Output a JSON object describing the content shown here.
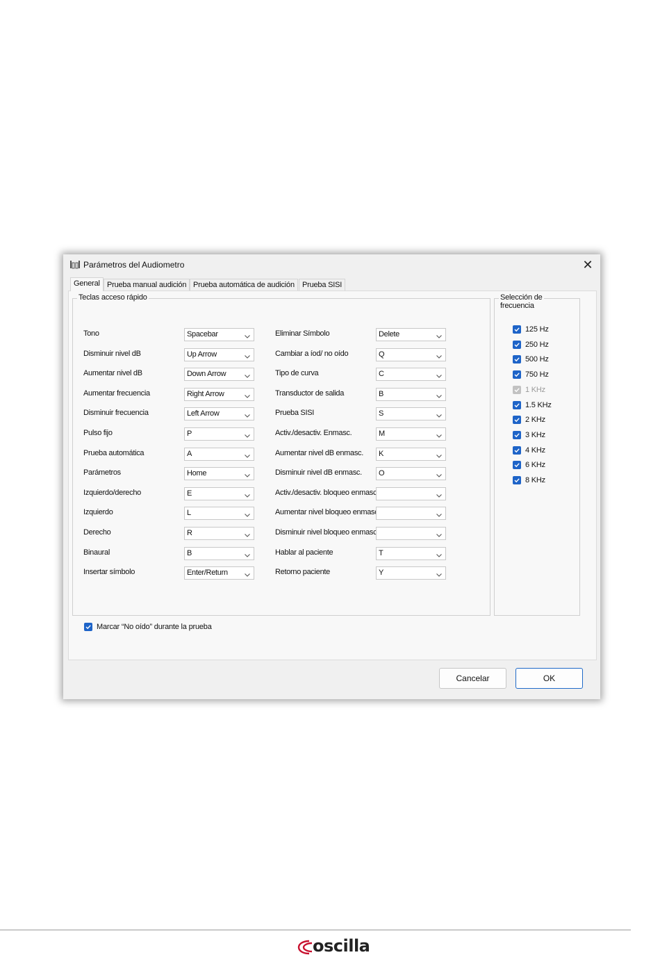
{
  "window": {
    "title": "Parámetros del Audiometro"
  },
  "tabs": [
    "General",
    "Prueba manual audición",
    "Prueba automática de audición",
    "Prueba SISI"
  ],
  "shortcuts": {
    "group_label": "Teclas acceso rápido",
    "left": [
      {
        "label": "Tono",
        "value": "Spacebar"
      },
      {
        "label": "Disminuir nivel dB",
        "value": "Up Arrow"
      },
      {
        "label": "Aumentar nivel dB",
        "value": "Down Arrow"
      },
      {
        "label": "Aumentar frecuencia",
        "value": "Right Arrow"
      },
      {
        "label": "Disminuir frecuencia",
        "value": "Left Arrow"
      },
      {
        "label": "Pulso fijo",
        "value": "P"
      },
      {
        "label": "Prueba automática",
        "value": "A"
      },
      {
        "label": "Parámetros",
        "value": "Home"
      },
      {
        "label": "Izquierdo/derecho",
        "value": "E"
      },
      {
        "label": "Izquierdo",
        "value": "L"
      },
      {
        "label": "Derecho",
        "value": "R"
      },
      {
        "label": "Binaural",
        "value": "B"
      },
      {
        "label": "Insertar símbolo",
        "value": "Enter/Return"
      }
    ],
    "right": [
      {
        "label": "Eliminar Símbolo",
        "value": "Delete"
      },
      {
        "label": "Cambiar a íod/ no oído",
        "value": "Q"
      },
      {
        "label": "Tipo de curva",
        "value": "C"
      },
      {
        "label": "Transductor de salida",
        "value": "B"
      },
      {
        "label": "Prueba SISI",
        "value": "S"
      },
      {
        "label": "Activ./desactiv. Enmasc.",
        "value": "M"
      },
      {
        "label": "Aumentar nivel dB enmasc.",
        "value": "K"
      },
      {
        "label": "Disminuir nivel dB enmasc.",
        "value": "O"
      },
      {
        "label": "Activ./desactiv. bloqueo enmasc.",
        "value": ""
      },
      {
        "label": "Aumentar nivel bloqueo enmasc.",
        "value": ""
      },
      {
        "label": "Disminuir nivel bloqueo enmasc.",
        "value": ""
      },
      {
        "label": "Hablar al paciente",
        "value": "T"
      },
      {
        "label": "Retorno paciente",
        "value": "Y"
      }
    ]
  },
  "frequency": {
    "group_label_line1": "Selección de",
    "group_label_line2": "frecuencia",
    "items": [
      {
        "label": "125 Hz",
        "checked": true,
        "disabled": false
      },
      {
        "label": "250 Hz",
        "checked": true,
        "disabled": false
      },
      {
        "label": "500 Hz",
        "checked": true,
        "disabled": false
      },
      {
        "label": "750 Hz",
        "checked": true,
        "disabled": false
      },
      {
        "label": "1 KHz",
        "checked": true,
        "disabled": true
      },
      {
        "label": "1.5 KHz",
        "checked": true,
        "disabled": false
      },
      {
        "label": "2 KHz",
        "checked": true,
        "disabled": false
      },
      {
        "label": "3 KHz",
        "checked": true,
        "disabled": false
      },
      {
        "label": "4 KHz",
        "checked": true,
        "disabled": false
      },
      {
        "label": "6 KHz",
        "checked": true,
        "disabled": false
      },
      {
        "label": "8 KHz",
        "checked": true,
        "disabled": false
      }
    ]
  },
  "mark_not_heard": {
    "label": "Marcar “No oído” durante la prueba",
    "checked": true
  },
  "buttons": {
    "cancel": "Cancelar",
    "ok": "OK"
  },
  "footer": {
    "logo_text": "oscilla"
  },
  "colors": {
    "accent": "#1e64c8",
    "logo_red": "#c8102e"
  }
}
